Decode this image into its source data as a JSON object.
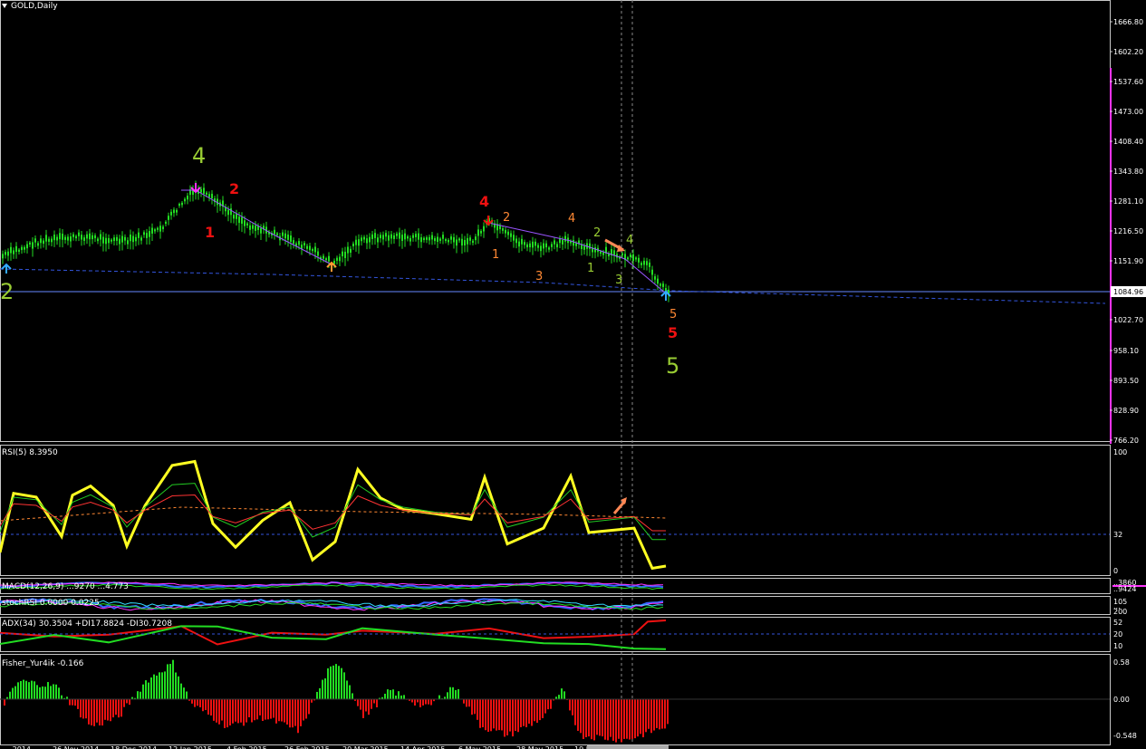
{
  "colors": {
    "background": "#000000",
    "frame": "#c8c8c8",
    "candle": "#22dd22",
    "rsi": "#ffff22",
    "bull": "#22dd22",
    "bear": "#ee1111",
    "dashed_level": "#3355dd",
    "current_price": "#6688ff",
    "scroll_marker": "#ff33ff"
  },
  "main_chart": {
    "title": "GOLD,Daily",
    "price_axis": [
      "1666.80",
      "1602.20",
      "1537.60",
      "1473.00",
      "1408.40",
      "1343.80",
      "1281.10",
      "1216.50",
      "1151.90",
      "1084.96",
      "1022.70",
      "958.10",
      "893.50",
      "828.90",
      "766.20"
    ],
    "current_price": "1084.96",
    "wave_labels": [
      {
        "text": "4",
        "color": "#99cc33",
        "size": "large"
      },
      {
        "text": "2",
        "color": "#99cc33",
        "size": "large"
      },
      {
        "text": "5",
        "color": "#99cc33",
        "size": "large"
      },
      {
        "text": "2",
        "color": "#ee1111",
        "size": "medium"
      },
      {
        "text": "1",
        "color": "#ee1111",
        "size": "medium"
      },
      {
        "text": "4",
        "color": "#ee1111",
        "size": "medium"
      },
      {
        "text": "5",
        "color": "#ee1111",
        "size": "medium"
      },
      {
        "text": "2",
        "color": "#ff8833",
        "size": "small"
      },
      {
        "text": "1",
        "color": "#ff8833",
        "size": "small"
      },
      {
        "text": "3",
        "color": "#ff8833",
        "size": "small"
      },
      {
        "text": "4",
        "color": "#ff8833",
        "size": "small"
      },
      {
        "text": "5",
        "color": "#ff8833",
        "size": "small"
      },
      {
        "text": "2",
        "color": "#99cc33",
        "size": "small"
      },
      {
        "text": "1",
        "color": "#99cc33",
        "size": "small"
      },
      {
        "text": "3",
        "color": "#99cc33",
        "size": "small"
      },
      {
        "text": "4",
        "color": "#99cc33",
        "size": "small"
      }
    ],
    "fractal_arrows": [
      "magenta-down-arrow",
      "red-down-arrow",
      "orange-up-arrow",
      "blue-up-arrow",
      "blue-up-arrow"
    ]
  },
  "rsi_panel": {
    "title": "RSI(5) 8.3950",
    "axis": [
      "100",
      "32",
      "0"
    ]
  },
  "macd_panel": {
    "title": "MACD(12,26,9) ...9270 ...4.773",
    "axis": [
      "..3860",
      "..9424"
    ]
  },
  "stoch_panel": {
    "title": "stochRSI 0.0000 0.0225",
    "axis": [
      "105",
      "...",
      "200"
    ]
  },
  "adx_panel": {
    "title": "ADX(34) 30.3504 +DI17.8824 -DI30.7208",
    "axis": [
      "52",
      "20",
      "10"
    ]
  },
  "fisher_panel": {
    "title": "Fisher_Yur4ik -0.166",
    "axis": [
      "0.58",
      "0.00",
      "-0.548"
    ]
  },
  "time_axis": [
    "...2014",
    "26 Nov 2014",
    "18 Dec 2014",
    "12 Jan 2015",
    "4 Feb 2015",
    "26 Feb 2015",
    "20 Mar 2015",
    "14 Apr 2015",
    "6 May 2015",
    "28 May 2015",
    "19 Jun 2015",
    "..."
  ]
}
